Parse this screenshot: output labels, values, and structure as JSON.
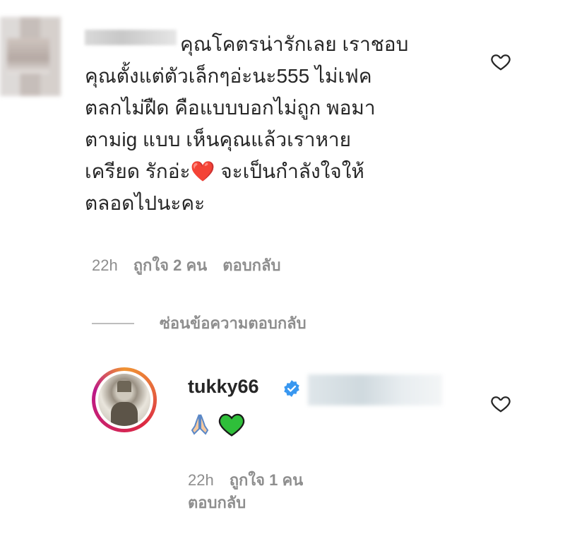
{
  "comment": {
    "text": "คุณโคตรน่ารักเลย เราชอบ\nคุณตั้งแต่ตัวเล็กๆอ่ะนะ555 ไม่เฟค\nตลกไม่ฝืด คือแบบบอกไม่ถูก พอมา\nตามig แบบ เห็นคุณแล้วเราหาย\nเครียด รักอ่ะ❤️ จะเป็นกำลังใจให้\nตลอดไปนะคะ",
    "time": "22h",
    "likes": "ถูกใจ 2 คน",
    "reply_label": "ตอบกลับ"
  },
  "hide_replies_label": "ซ่อนข้อความตอบกลับ",
  "reply": {
    "username": "tukky66",
    "emojis": "🙏💚",
    "time": "22h",
    "likes": "ถูกใจ 1 คน",
    "reply_label": "ตอบกลับ"
  },
  "colors": {
    "text": "#262626",
    "muted": "#8e8e8e",
    "verified": "#3897f0",
    "heart_red": "#e0102a",
    "heart_green": "#2fbf3a"
  }
}
